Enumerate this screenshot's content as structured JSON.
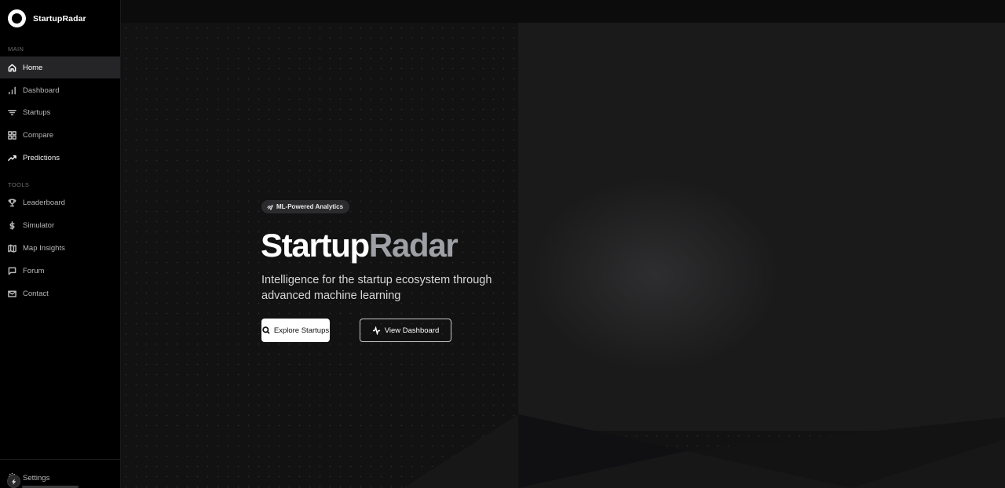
{
  "sidebar": {
    "brand": "StartupRadar",
    "sections": {
      "main": "MAIN",
      "tools": "TOOLS"
    },
    "main_items": [
      {
        "label": "Home",
        "icon": "home-icon"
      },
      {
        "label": "Dashboard",
        "icon": "bar-chart-icon"
      },
      {
        "label": "Startups",
        "icon": "filter-icon"
      },
      {
        "label": "Compare",
        "icon": "grid-icon"
      },
      {
        "label": "Predictions",
        "icon": "trending-up-icon"
      }
    ],
    "tool_items": [
      {
        "label": "Leaderboard",
        "icon": "trophy-icon"
      },
      {
        "label": "Simulator",
        "icon": "dollar-icon"
      },
      {
        "label": "Map Insights",
        "icon": "map-icon"
      },
      {
        "label": "Forum",
        "icon": "message-icon"
      },
      {
        "label": "Contact",
        "icon": "mail-icon"
      }
    ],
    "footer": {
      "settings": "Settings"
    }
  },
  "hero": {
    "badge": "ML-Powered Analytics",
    "title_part1": "Startup",
    "title_part2": "Radar",
    "subtitle": "Intelligence for the startup ecosystem through advanced machine learning",
    "primary_button": "Explore Startups",
    "secondary_button": "View Dashboard"
  },
  "colors": {
    "accent_white": "#ffffff",
    "title_gray": "#9ea0a6",
    "sidebar_bg": "#000000",
    "active_item_bg": "#252527"
  }
}
